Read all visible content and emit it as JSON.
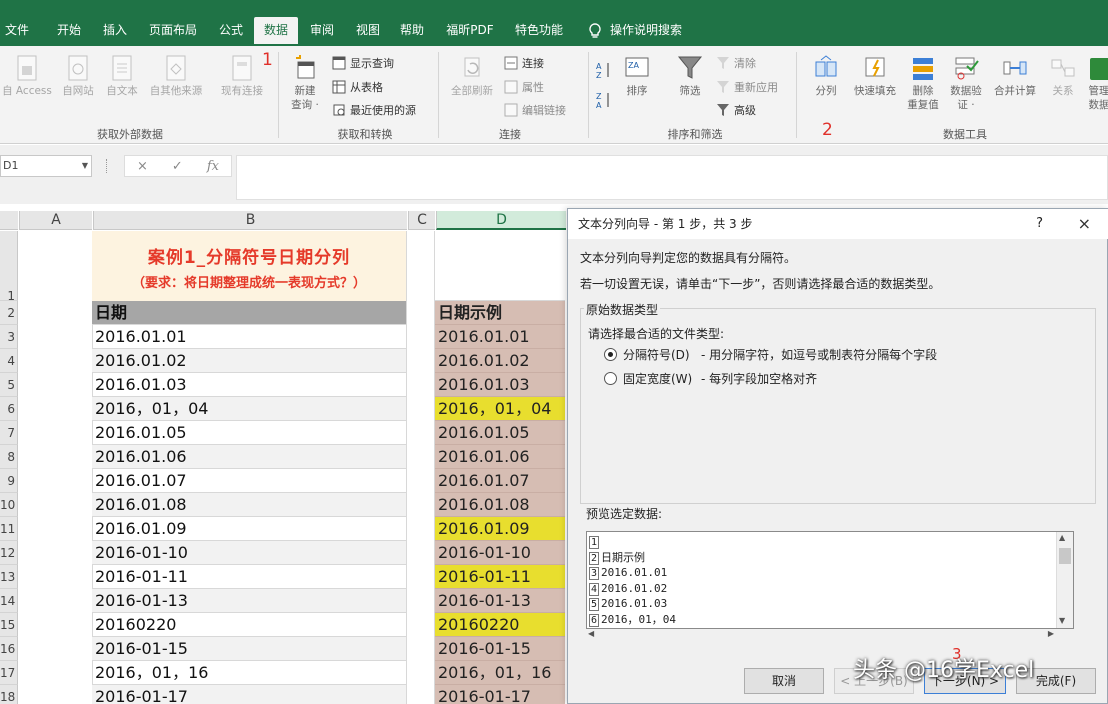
{
  "ribbon_tabs": [
    "文件",
    "开始",
    "插入",
    "页面布局",
    "公式",
    "数据",
    "审阅",
    "视图",
    "帮助",
    "福昕PDF",
    "特色功能"
  ],
  "active_tab_index": 5,
  "tell_me": "操作说明搜索",
  "ribbon": {
    "group1": {
      "label": "获取外部数据",
      "buttons": [
        "自 Access",
        "自网站",
        "自文本",
        "自其他来源",
        "现有连接"
      ]
    },
    "group2": {
      "label": "获取和转换",
      "new_query": "新建\n查询 ·",
      "show_query": "显示查询",
      "from_table": "从表格",
      "recent_sources": "最近使用的源"
    },
    "group3": {
      "label": "连接",
      "refresh_all": "全部刷新",
      "connections": "连接",
      "properties": "属性",
      "edit_links": "编辑链接"
    },
    "group4": {
      "label": "排序和筛选",
      "sort": "排序",
      "filter": "筛选",
      "clear": "清除",
      "reapply": "重新应用",
      "advanced": "高级"
    },
    "group5": {
      "label": "数据工具",
      "text_to_columns": "分列",
      "flash_fill": "快速填充",
      "remove_duplicates": "删除\n重复值",
      "data_validation": "数据验\n证 ·",
      "consolidate": "合并计算",
      "relationships": "关系",
      "manage": "管理\n数据"
    },
    "annotation1": "1",
    "annotation2": "2"
  },
  "formula_bar": {
    "name_box": "D1",
    "cancel": "×",
    "confirm": "✓",
    "fx": "fx"
  },
  "columns": [
    "A",
    "B",
    "C",
    "D"
  ],
  "sheet": {
    "title_line1": "案例1_分隔符号日期分列",
    "title_line2": "（要求：将日期整理成统一表现方式？）",
    "rows": [
      "1",
      "2",
      "3",
      "4",
      "5",
      "6",
      "7",
      "8",
      "9",
      "10",
      "11",
      "12",
      "13",
      "14",
      "15",
      "16",
      "17",
      "18"
    ],
    "col_b": [
      "日期",
      "2016.01.01",
      "2016.01.02",
      "2016.01.03",
      "2016，01，04",
      "2016.01.05",
      "2016.01.06",
      "2016.01.07",
      "2016.01.08",
      "2016.01.09",
      "2016-01-10",
      "2016-01-11",
      "2016-01-13",
      "20160220",
      "2016-01-15",
      "2016，01，16",
      "2016-01-17"
    ],
    "col_d": [
      "日期示例",
      "2016.01.01",
      "2016.01.02",
      "2016.01.03",
      "2016，01，04",
      "2016.01.05",
      "2016.01.06",
      "2016.01.07",
      "2016.01.08",
      "2016.01.09",
      "2016-01-10",
      "2016-01-11",
      "2016-01-13",
      "20160220",
      "2016-01-15",
      "2016，01，16",
      "2016-01-17"
    ],
    "highlight_rows": [
      4,
      9,
      11,
      13
    ]
  },
  "dialog": {
    "title": "文本分列向导 - 第 1 步，共 3 步",
    "help": "?",
    "close": "×",
    "line1": "文本分列向导判定您的数据具有分隔符。",
    "line2": "若一切设置无误，请单击“下一步”，否则请选择最合适的数据类型。",
    "group_label": "原始数据类型",
    "choose_label": "请选择最合适的文件类型:",
    "option1": "分隔符号(D)",
    "option1_desc": "- 用分隔字符，如逗号或制表符分隔每个字段",
    "option2": "固定宽度(W)",
    "option2_desc": "- 每列字段加空格对齐",
    "preview_label": "预览选定数据:",
    "preview_lines": [
      {
        "num": "1",
        "text": ""
      },
      {
        "num": "2",
        "text": "日期示例"
      },
      {
        "num": "3",
        "text": "2016.01.01"
      },
      {
        "num": "4",
        "text": "2016.01.02"
      },
      {
        "num": "5",
        "text": "2016.01.03"
      },
      {
        "num": "6",
        "text": "2016，01，04"
      }
    ],
    "buttons": {
      "cancel": "取消",
      "back": "< 上一步(B)",
      "next": "下一步(N) >",
      "finish": "完成(F)"
    },
    "annotation3": "3"
  },
  "watermark": "头条 @16学Excel",
  "colors": {
    "excel_green": "#1f7346",
    "highlight_yellow": "#e8de2e",
    "col_d_fill": "#d6bdb3",
    "title_red": "#e53a2a"
  }
}
